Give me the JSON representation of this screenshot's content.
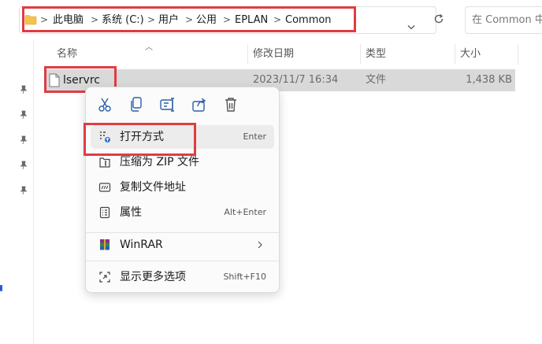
{
  "address": {
    "crumbs": [
      "此电脑",
      "系统 (C:)",
      "用户",
      "公用",
      "EPLAN",
      "Common"
    ],
    "separator": ">"
  },
  "search": {
    "placeholder": "在 Common 中搜"
  },
  "columns": {
    "name": "名称",
    "modified": "修改日期",
    "type": "类型",
    "size": "大小"
  },
  "file": {
    "name": "lservrc",
    "modified": "2023/11/7 16:34",
    "type": "文件",
    "size": "1,438 KB"
  },
  "context_menu": {
    "quick_actions": [
      "cut-icon",
      "copy-icon",
      "rename-icon",
      "share-icon",
      "delete-icon"
    ],
    "items": [
      {
        "label": "打开方式",
        "shortcut": "Enter",
        "icon": "open-with-icon"
      },
      {
        "label": "压缩为 ZIP 文件",
        "shortcut": "",
        "icon": "zip-icon"
      },
      {
        "label": "复制文件地址",
        "shortcut": "",
        "icon": "copy-path-icon"
      },
      {
        "label": "属性",
        "shortcut": "Alt+Enter",
        "icon": "properties-icon"
      },
      {
        "label": "WinRAR",
        "shortcut": "",
        "icon": "winrar-icon",
        "submenu": true
      },
      {
        "label": "显示更多选项",
        "shortcut": "Shift+F10",
        "icon": "more-options-icon"
      }
    ]
  },
  "colors": {
    "highlight_box": "#e03c43",
    "row_selected": "#d9d9d9",
    "folder": "#f3c24b"
  }
}
